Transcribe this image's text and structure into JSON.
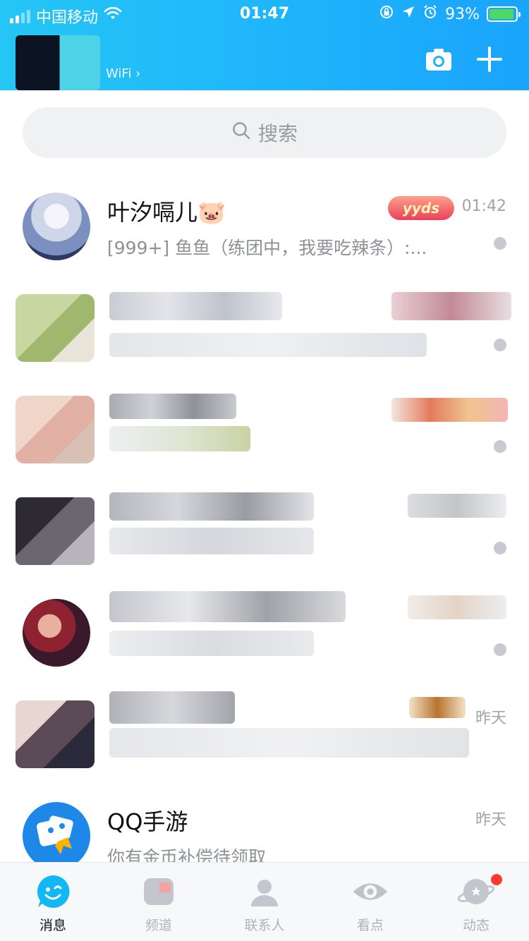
{
  "status_bar": {
    "carrier": "中国移动",
    "time": "01:47",
    "battery_percent": "93%",
    "battery_level": 0.93
  },
  "header": {
    "network_status": "WiFi ›",
    "camera_icon": "camera-icon",
    "add_icon": "plus-icon"
  },
  "search": {
    "placeholder": "搜索"
  },
  "conversations": [
    {
      "name": "叶汐嗝儿🐷",
      "badge": "yyds",
      "preview": "[999+] 鱼鱼（练团中，我要吃辣条）:...",
      "time": "01:42"
    },
    {
      "name": "",
      "preview": "",
      "time": ""
    },
    {
      "name": "",
      "preview": "",
      "time": ""
    },
    {
      "name": "",
      "preview": "",
      "time": ""
    },
    {
      "name": "",
      "preview": "",
      "time": ""
    },
    {
      "name": "",
      "preview": "",
      "time": "昨天"
    },
    {
      "name": "QQ手游",
      "preview": "你有金币补偿待领取",
      "time": "昨天"
    }
  ],
  "tabs": [
    {
      "label": "消息",
      "icon": "message-face-icon",
      "active": true
    },
    {
      "label": "频道",
      "icon": "channel-icon",
      "active": false
    },
    {
      "label": "联系人",
      "icon": "contacts-icon",
      "active": false
    },
    {
      "label": "看点",
      "icon": "eye-icon",
      "active": false
    },
    {
      "label": "动态",
      "icon": "planet-icon",
      "active": false,
      "has_red_dot": true
    }
  ],
  "colors": {
    "header_gradient_start": "#25c6f5",
    "header_gradient_end": "#1aa4fc",
    "accent_blue": "#12b7f5",
    "unread_dot": "#c7cad0",
    "notification_red": "#ff3b30"
  }
}
